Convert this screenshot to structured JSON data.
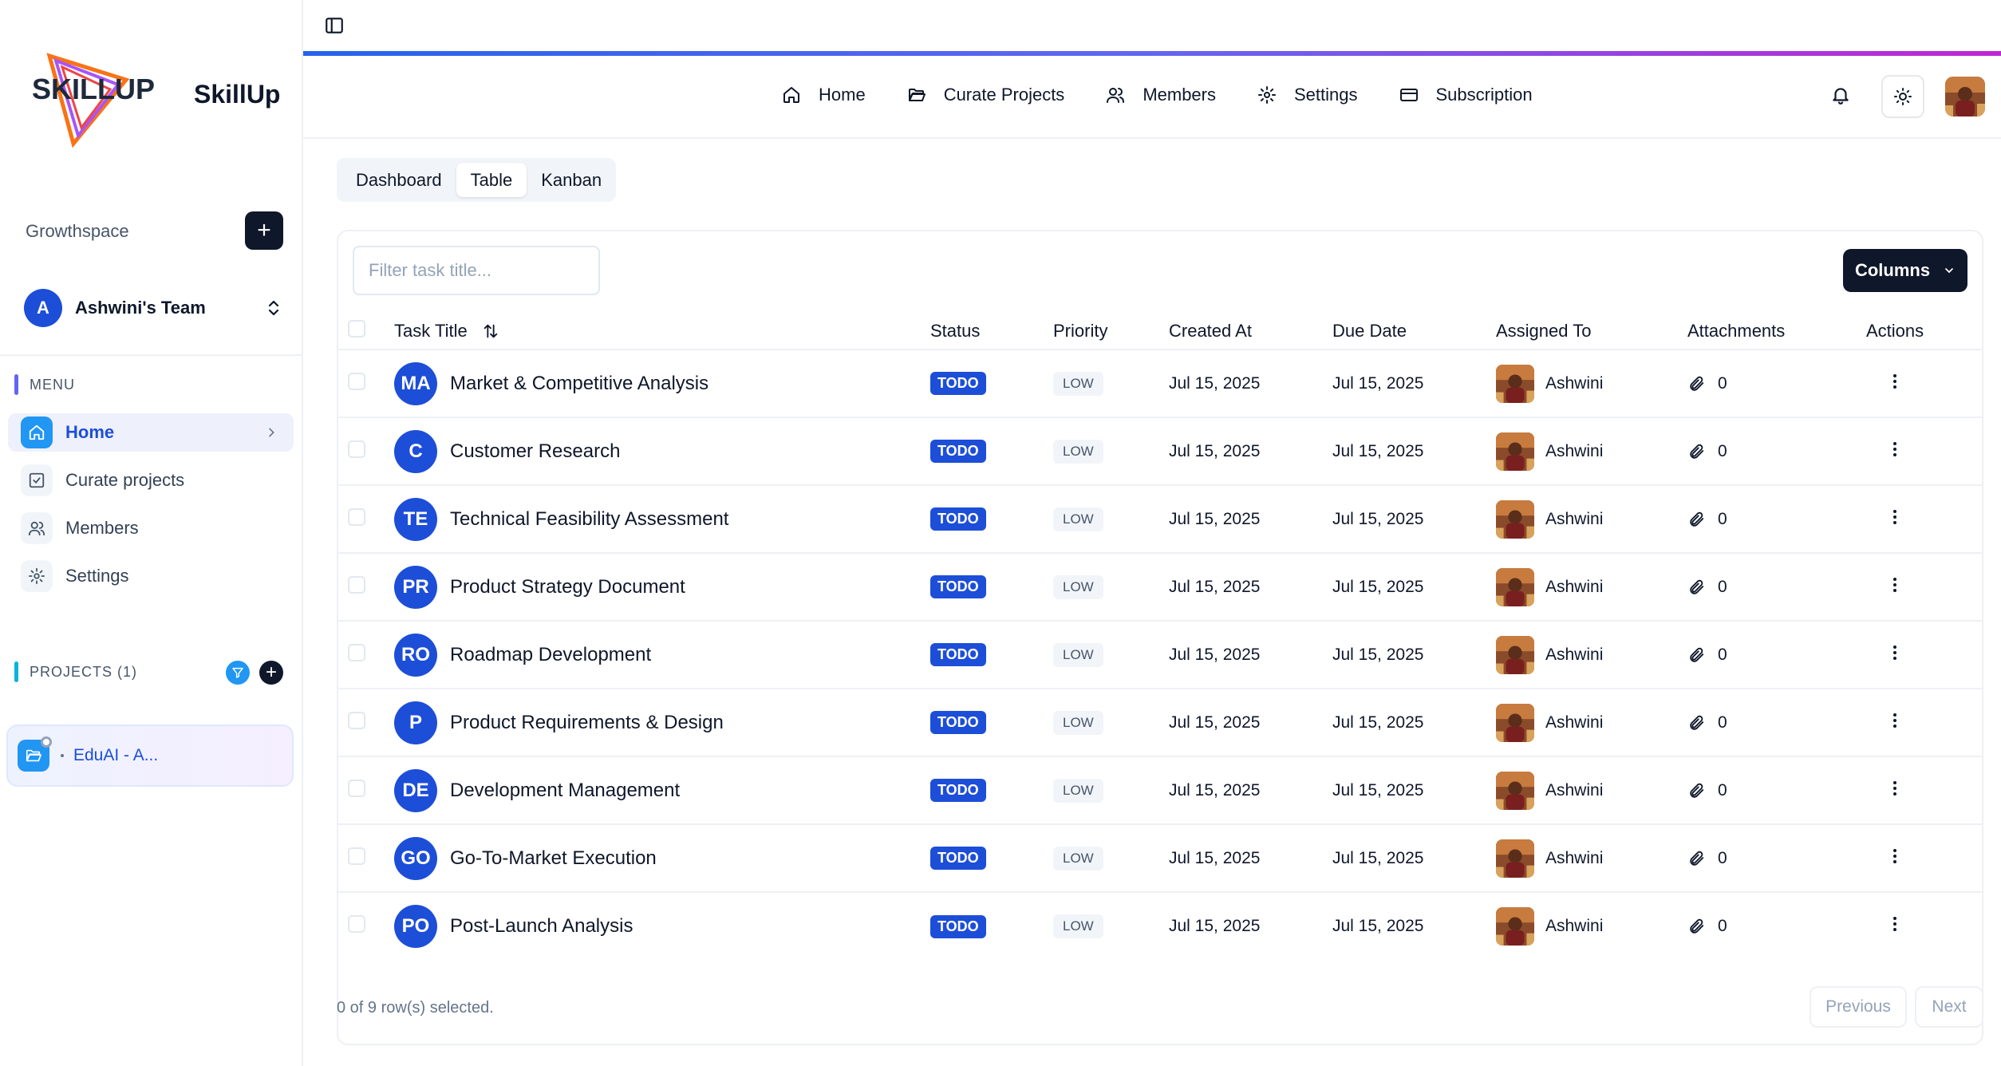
{
  "brand": {
    "logo_text": "SKILLUP",
    "name": "SkillUp"
  },
  "workspace": {
    "label": "Growthspace",
    "add_symbol": "+"
  },
  "team": {
    "initial": "A",
    "name": "Ashwini's Team"
  },
  "menu": {
    "label": "MENU",
    "items": [
      {
        "label": "Home",
        "icon": "home-icon",
        "active": true
      },
      {
        "label": "Curate projects",
        "icon": "check-square-icon",
        "active": false
      },
      {
        "label": "Members",
        "icon": "users-icon",
        "active": false
      },
      {
        "label": "Settings",
        "icon": "gear-icon",
        "active": false
      }
    ]
  },
  "projects": {
    "label": "PROJECTS (1)",
    "add_symbol": "+",
    "items": [
      {
        "name": "EduAI - A..."
      }
    ]
  },
  "topnav": {
    "items": [
      {
        "label": "Home",
        "icon": "home-icon"
      },
      {
        "label": "Curate Projects",
        "icon": "folder-icon"
      },
      {
        "label": "Members",
        "icon": "users-icon"
      },
      {
        "label": "Settings",
        "icon": "gear-icon"
      },
      {
        "label": "Subscription",
        "icon": "card-icon"
      }
    ]
  },
  "view_tabs": [
    {
      "label": "Dashboard",
      "active": false
    },
    {
      "label": "Table",
      "active": true
    },
    {
      "label": "Kanban",
      "active": false
    }
  ],
  "table": {
    "filter_placeholder": "Filter task title...",
    "columns_button": "Columns",
    "headers": [
      "Task Title",
      "Status",
      "Priority",
      "Created At",
      "Due Date",
      "Assigned To",
      "Attachments",
      "Actions"
    ],
    "rows": [
      {
        "initials": "MA",
        "title": "Market & Competitive Analysis",
        "status": "TODO",
        "priority": "LOW",
        "created": "Jul 15, 2025",
        "due": "Jul 15, 2025",
        "assignee": "Ashwini",
        "attachments": "0"
      },
      {
        "initials": "C",
        "title": "Customer Research",
        "status": "TODO",
        "priority": "LOW",
        "created": "Jul 15, 2025",
        "due": "Jul 15, 2025",
        "assignee": "Ashwini",
        "attachments": "0"
      },
      {
        "initials": "TE",
        "title": "Technical Feasibility Assessment",
        "status": "TODO",
        "priority": "LOW",
        "created": "Jul 15, 2025",
        "due": "Jul 15, 2025",
        "assignee": "Ashwini",
        "attachments": "0"
      },
      {
        "initials": "PR",
        "title": "Product Strategy Document",
        "status": "TODO",
        "priority": "LOW",
        "created": "Jul 15, 2025",
        "due": "Jul 15, 2025",
        "assignee": "Ashwini",
        "attachments": "0"
      },
      {
        "initials": "RO",
        "title": "Roadmap Development",
        "status": "TODO",
        "priority": "LOW",
        "created": "Jul 15, 2025",
        "due": "Jul 15, 2025",
        "assignee": "Ashwini",
        "attachments": "0"
      },
      {
        "initials": "P",
        "title": "Product Requirements & Design",
        "status": "TODO",
        "priority": "LOW",
        "created": "Jul 15, 2025",
        "due": "Jul 15, 2025",
        "assignee": "Ashwini",
        "attachments": "0"
      },
      {
        "initials": "DE",
        "title": "Development Management",
        "status": "TODO",
        "priority": "LOW",
        "created": "Jul 15, 2025",
        "due": "Jul 15, 2025",
        "assignee": "Ashwini",
        "attachments": "0"
      },
      {
        "initials": "GO",
        "title": "Go-To-Market Execution",
        "status": "TODO",
        "priority": "LOW",
        "created": "Jul 15, 2025",
        "due": "Jul 15, 2025",
        "assignee": "Ashwini",
        "attachments": "0"
      },
      {
        "initials": "PO",
        "title": "Post-Launch Analysis",
        "status": "TODO",
        "priority": "LOW",
        "created": "Jul 15, 2025",
        "due": "Jul 15, 2025",
        "assignee": "Ashwini",
        "attachments": "0"
      }
    ],
    "selection_text": "0 of 9 row(s) selected.",
    "prev_label": "Previous",
    "next_label": "Next"
  },
  "colors": {
    "accent": "#1d4ed8",
    "sky": "#2196f3",
    "dark": "#0f172a"
  }
}
